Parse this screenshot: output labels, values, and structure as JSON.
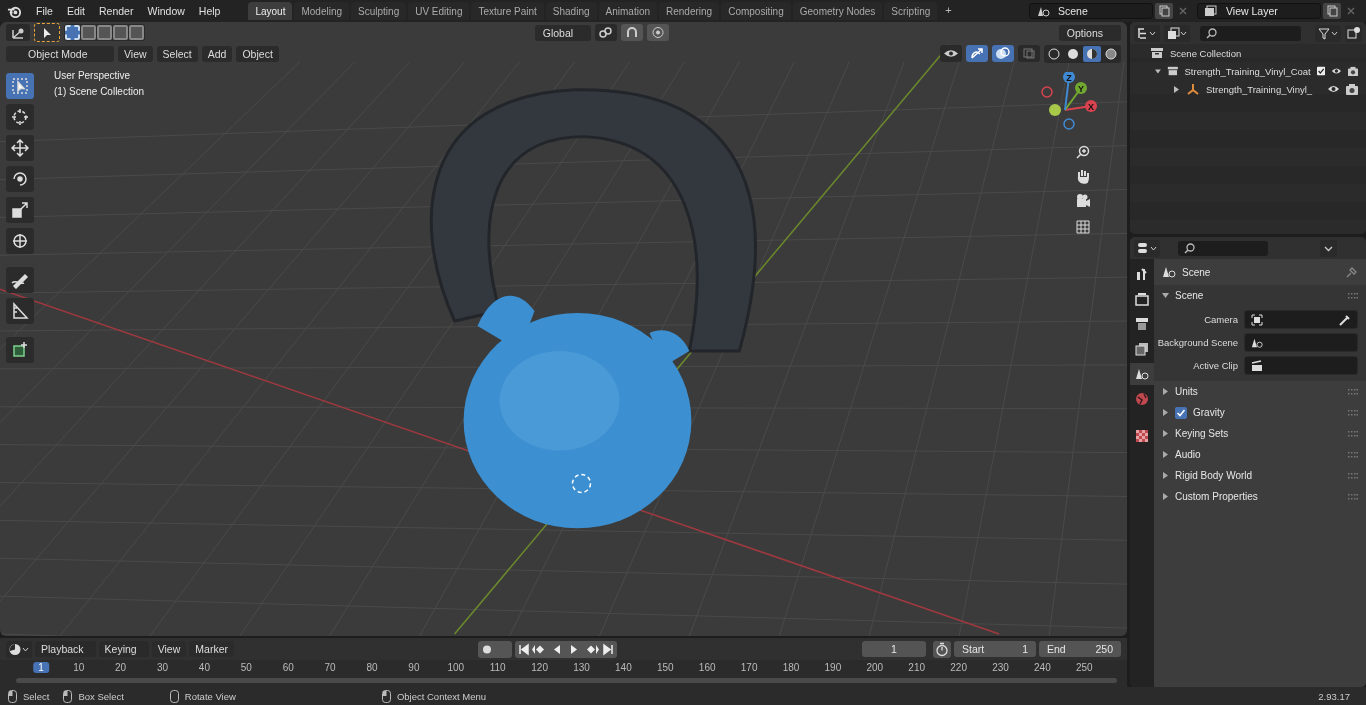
{
  "top_bar": {
    "menus": [
      "File",
      "Edit",
      "Render",
      "Window",
      "Help"
    ],
    "workspace_tabs": [
      {
        "label": "Layout",
        "selected": true
      },
      {
        "label": "Modeling",
        "selected": false
      },
      {
        "label": "Sculpting",
        "selected": false
      },
      {
        "label": "UV Editing",
        "selected": false
      },
      {
        "label": "Texture Paint",
        "selected": false
      },
      {
        "label": "Shading",
        "selected": false
      },
      {
        "label": "Animation",
        "selected": false
      },
      {
        "label": "Rendering",
        "selected": false
      },
      {
        "label": "Compositing",
        "selected": false
      },
      {
        "label": "Geometry Nodes",
        "selected": false
      },
      {
        "label": "Scripting",
        "selected": false
      }
    ],
    "add_tab": "+",
    "scene": "Scene",
    "view_layer": "View Layer"
  },
  "viewport": {
    "orientation": "Global",
    "options": "Options",
    "mode": "Object Mode",
    "menus": [
      "View",
      "Select",
      "Add",
      "Object"
    ],
    "shading": [
      {
        "kind": "wireframe",
        "selected": false
      },
      {
        "kind": "solid",
        "selected": false
      },
      {
        "kind": "material",
        "selected": true
      },
      {
        "kind": "rendered",
        "selected": false
      }
    ],
    "view_name": "User Perspective",
    "collection": "(1) Scene Collection",
    "tools": [
      {
        "kind": "select",
        "selected": true
      },
      {
        "kind": "cursor",
        "selected": false
      },
      {
        "kind": "move",
        "selected": false
      },
      {
        "kind": "rotate",
        "selected": false
      },
      {
        "kind": "scale",
        "selected": false
      },
      {
        "kind": "transform",
        "selected": false
      },
      {
        "kind": "annotate",
        "selected": false
      },
      {
        "kind": "measure",
        "selected": false
      },
      {
        "kind": "add_cube",
        "selected": false
      }
    ],
    "gizmo_axes": [
      "X",
      "Y",
      "Z"
    ]
  },
  "outliner": {
    "root": "Scene Collection",
    "items": [
      {
        "label": "Strength_Training_Vinyl_Coat",
        "expanded": true,
        "checked": true,
        "children": [
          {
            "label": "Strength_Training_Vinyl_",
            "expanded": false
          }
        ]
      }
    ]
  },
  "properties": {
    "tabs": [
      {
        "kind": "tool",
        "selected": false
      },
      {
        "kind": "render",
        "selected": false
      },
      {
        "kind": "output",
        "selected": false
      },
      {
        "kind": "view_layer",
        "selected": false
      },
      {
        "kind": "scene",
        "selected": true
      },
      {
        "kind": "world",
        "selected": false
      },
      {
        "kind": "texture",
        "selected": false
      }
    ],
    "header": "Scene",
    "section": {
      "title": "Scene",
      "expanded": true,
      "fields": [
        {
          "label": "Camera",
          "kind": "camera"
        },
        {
          "label": "Background Scene",
          "kind": "scene"
        },
        {
          "label": "Active Clip",
          "kind": "clip"
        }
      ]
    },
    "panels": [
      {
        "label": "Units",
        "kind": "plain"
      },
      {
        "label": "Gravity",
        "kind": "checkbox",
        "checked": true
      },
      {
        "label": "Keying Sets",
        "kind": "plain"
      },
      {
        "label": "Audio",
        "kind": "plain"
      },
      {
        "label": "Rigid Body World",
        "kind": "plain"
      },
      {
        "label": "Custom Properties",
        "kind": "plain"
      }
    ]
  },
  "timeline": {
    "menus": [
      "Playback",
      "Keying",
      "View",
      "Marker"
    ],
    "current_frame": "1",
    "start_label": "Start",
    "start": "1",
    "end_label": "End",
    "end": "250",
    "ruler": [
      "1",
      "10",
      "20",
      "30",
      "40",
      "50",
      "60",
      "70",
      "80",
      "90",
      "100",
      "110",
      "120",
      "130",
      "140",
      "150",
      "160",
      "170",
      "180",
      "190",
      "200",
      "210",
      "220",
      "230",
      "240",
      "250"
    ]
  },
  "status_bar": {
    "hints": [
      "Select",
      "Box Select",
      "Rotate View",
      "Object Context Menu"
    ],
    "version": "2.93.17"
  }
}
